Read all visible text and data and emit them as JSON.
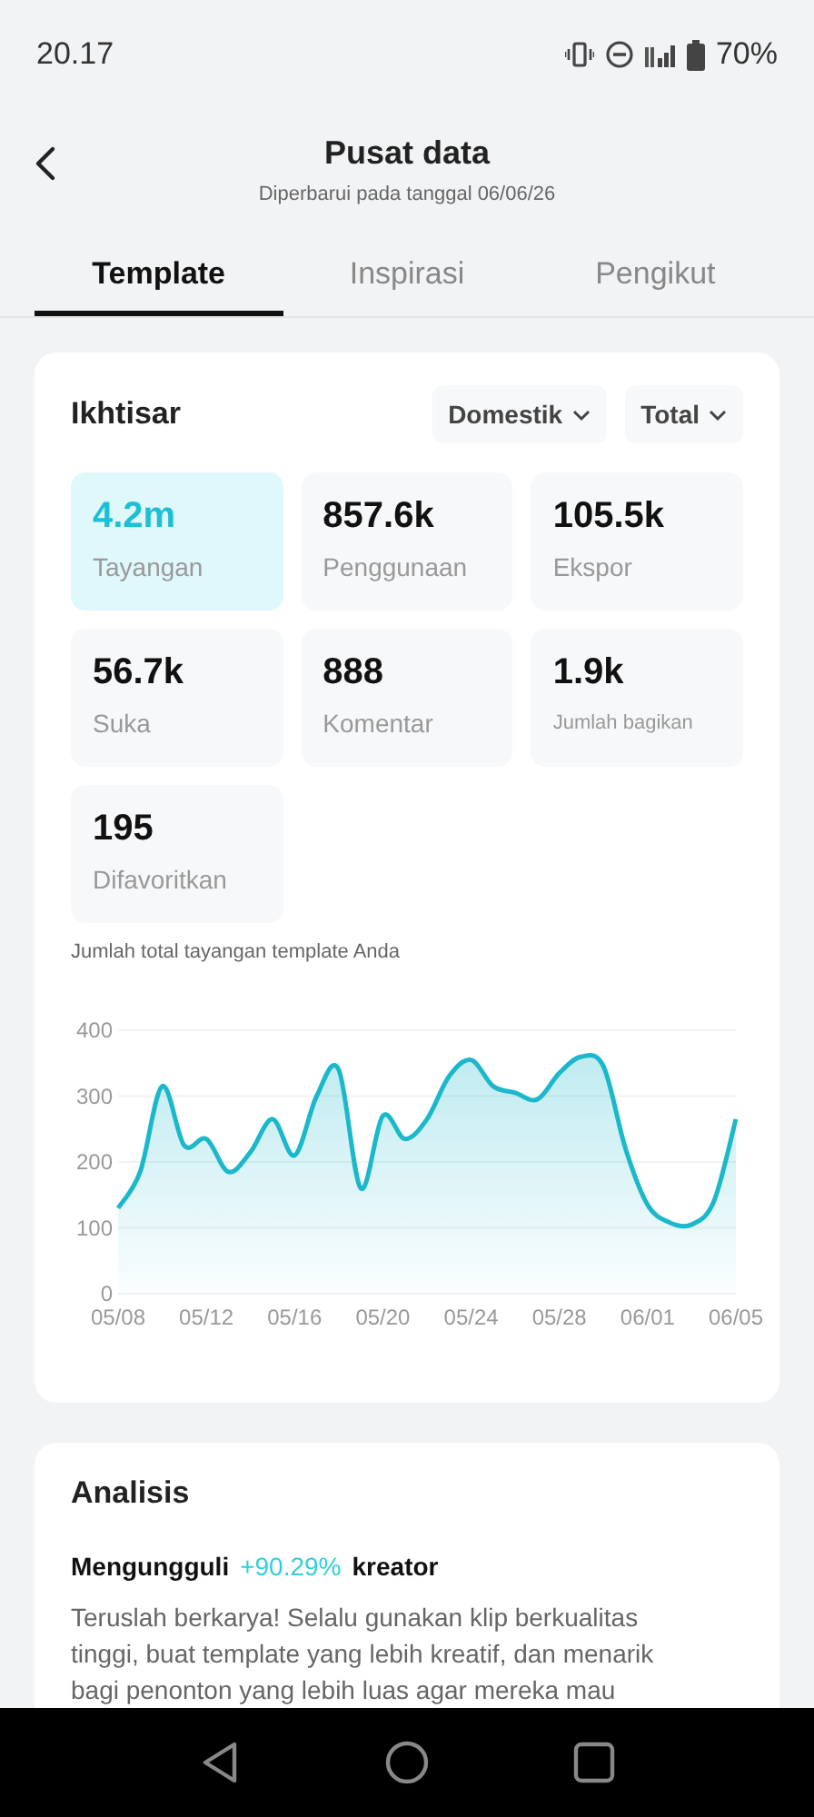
{
  "status_bar": {
    "time": "20.17",
    "battery": "70%"
  },
  "header": {
    "title": "Pusat data",
    "subtitle": "Diperbarui pada tanggal 06/06/26"
  },
  "tabs": [
    {
      "label": "Template",
      "selected": true
    },
    {
      "label": "Inspirasi",
      "selected": false
    },
    {
      "label": "Pengikut",
      "selected": false
    }
  ],
  "overview": {
    "title": "Ikhtisar",
    "filters": [
      {
        "label": "Domestik"
      },
      {
        "label": "Total"
      }
    ],
    "metrics": [
      {
        "value": "4.2m",
        "label": "Tayangan",
        "selected": true
      },
      {
        "value": "857.6k",
        "label": "Penggunaan",
        "selected": false
      },
      {
        "value": "105.5k",
        "label": "Ekspor",
        "selected": false
      },
      {
        "value": "56.7k",
        "label": "Suka",
        "selected": false
      },
      {
        "value": "888",
        "label": "Komentar",
        "selected": false
      },
      {
        "value": "1.9k",
        "label": "Jumlah bagikan",
        "selected": false
      },
      {
        "value": "195",
        "label": "Difavoritkan",
        "selected": false
      }
    ],
    "caption": "Jumlah total tayangan template Anda",
    "chart_data": {
      "type": "area",
      "categories": [
        "05/08",
        null,
        null,
        null,
        "05/12",
        null,
        null,
        null,
        "05/16",
        null,
        null,
        null,
        "05/20",
        null,
        null,
        null,
        "05/24",
        null,
        null,
        null,
        "05/28",
        null,
        null,
        null,
        "06/01",
        null,
        null,
        null,
        "06/05"
      ],
      "grid": true,
      "series": [
        {
          "color": "#1bb8cc",
          "values": [
            130,
            185,
            315,
            225,
            235,
            185,
            215,
            265,
            210,
            300,
            340,
            160,
            270,
            235,
            265,
            330,
            355,
            315,
            305,
            295,
            335,
            360,
            345,
            220,
            135,
            108,
            105,
            140,
            265
          ]
        }
      ],
      "ylim": [
        0,
        400
      ],
      "yticks": [
        0,
        100,
        200,
        300,
        400
      ]
    }
  },
  "analysis": {
    "title": "Analisis",
    "headline": {
      "prefix": "Mengungguli",
      "highlight": "+90.29%",
      "suffix": "kreator"
    },
    "body": "Teruslah berkarya! Selalu gunakan klip berkualitas tinggi, buat template yang lebih kreatif, dan menarik bagi penonton yang lebih luas agar mereka mau"
  }
}
